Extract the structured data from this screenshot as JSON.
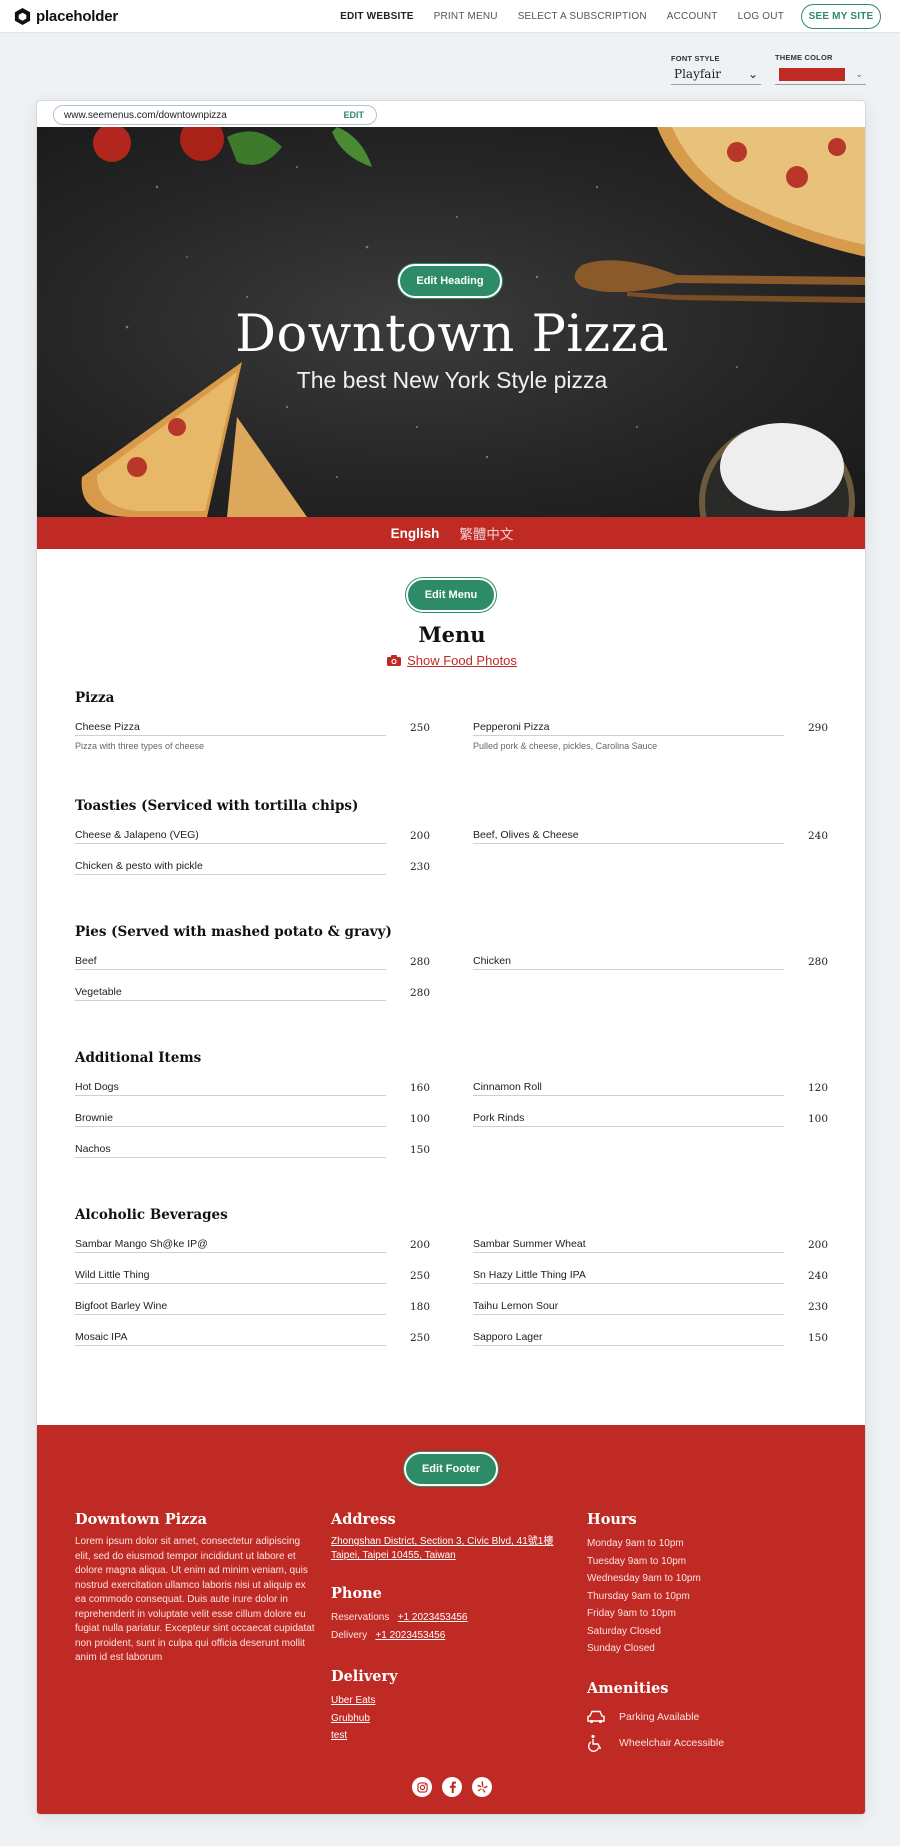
{
  "brand": {
    "name": "placeholder"
  },
  "nav": {
    "links": [
      "EDIT WEBSITE",
      "PRINT MENU",
      "SELECT A SUBSCRIPTION",
      "ACCOUNT",
      "LOG OUT"
    ],
    "cta": "SEE MY SITE"
  },
  "controls": {
    "font_label": "FONT STYLE",
    "font_value": "Playfair",
    "color_label": "THEME COLOR",
    "theme_color": "#c02a24"
  },
  "url": {
    "value": "www.seemenus.com/downtownpizza",
    "edit": "EDIT"
  },
  "hero": {
    "edit": "Edit Heading",
    "title": "Downtown Pizza",
    "subtitle": "The best New York Style pizza"
  },
  "languages": [
    "English",
    "繁體中文"
  ],
  "menu": {
    "edit": "Edit Menu",
    "title": "Menu",
    "photos_link": "Show Food Photos",
    "sections": [
      {
        "title": "Pizza",
        "items": [
          {
            "name": "Cheese Pizza",
            "price": "250",
            "desc": "Pizza with three types of cheese"
          },
          {
            "name": "Pepperoni Pizza",
            "price": "290",
            "desc": "Pulled pork & cheese, pickles, Carolina Sauce"
          }
        ]
      },
      {
        "title": "Toasties (Serviced with tortilla chips)",
        "items": [
          {
            "name": "Cheese & Jalapeno (VEG)",
            "price": "200"
          },
          {
            "name": "Beef, Olives & Cheese",
            "price": "240"
          },
          {
            "name": "Chicken & pesto with pickle",
            "price": "230"
          }
        ]
      },
      {
        "title": "Pies (Served with mashed potato & gravy)",
        "items": [
          {
            "name": "Beef",
            "price": "280"
          },
          {
            "name": "Chicken",
            "price": "280"
          },
          {
            "name": "Vegetable",
            "price": "280"
          }
        ]
      },
      {
        "title": "Additional Items",
        "items": [
          {
            "name": "Hot Dogs",
            "price": "160"
          },
          {
            "name": "Cinnamon Roll",
            "price": "120"
          },
          {
            "name": "Brownie",
            "price": "100"
          },
          {
            "name": "Pork Rinds",
            "price": "100"
          },
          {
            "name": "Nachos",
            "price": "150"
          }
        ]
      },
      {
        "title": "Alcoholic Beverages",
        "items": [
          {
            "name": "Sambar Mango Sh@ke IP@",
            "price": "200"
          },
          {
            "name": "Sambar Summer Wheat",
            "price": "200"
          },
          {
            "name": "Wild Little Thing",
            "price": "250"
          },
          {
            "name": "Sn Hazy Little Thing IPA",
            "price": "240"
          },
          {
            "name": "Bigfoot Barley Wine",
            "price": "180"
          },
          {
            "name": "Taihu Lemon Sour",
            "price": "230"
          },
          {
            "name": "Mosaic IPA",
            "price": "250"
          },
          {
            "name": "Sapporo Lager",
            "price": "150"
          }
        ]
      }
    ]
  },
  "footer": {
    "edit": "Edit Footer",
    "about_title": "Downtown Pizza",
    "about_text": "Lorem ipsum dolor sit amet, consectetur adipiscing elit, sed do eiusmod tempor incididunt ut labore et dolore magna aliqua. Ut enim ad minim veniam, quis nostrud exercitation ullamco laboris nisi ut aliquip ex ea commodo consequat. Duis aute irure dolor in reprehenderit in voluptate velit esse cillum dolore eu fugiat nulla pariatur. Excepteur sint occaecat cupidatat non proident, sunt in culpa qui officia deserunt mollit anim id est laborum",
    "address_title": "Address",
    "address_line1": "Zhongshan District, Section 3, Civic Blvd, 41號1樓",
    "address_line2": "Taipei, Taipei 10455, Taiwan",
    "phone_title": "Phone",
    "reservations_label": "Reservations",
    "reservations_phone": "+1 2023453456",
    "delivery_label": "Delivery",
    "delivery_phone": "+1 2023453456",
    "delivery_title": "Delivery",
    "delivery_links": [
      "Uber Eats",
      "Grubhub",
      "test"
    ],
    "hours_title": "Hours",
    "hours": [
      "Monday 9am to 10pm",
      "Tuesday 9am to 10pm",
      "Wednesday 9am to 10pm",
      "Thursday 9am to 10pm",
      "Friday 9am to 10pm",
      "Saturday Closed",
      "Sunday Closed"
    ],
    "amenities_title": "Amenities",
    "amenities": [
      {
        "icon": "car-icon",
        "label": "Parking Available"
      },
      {
        "icon": "wheelchair-icon",
        "label": "Wheelchair Accessible"
      }
    ],
    "social": [
      "instagram-icon",
      "facebook-icon",
      "yelp-icon"
    ]
  }
}
